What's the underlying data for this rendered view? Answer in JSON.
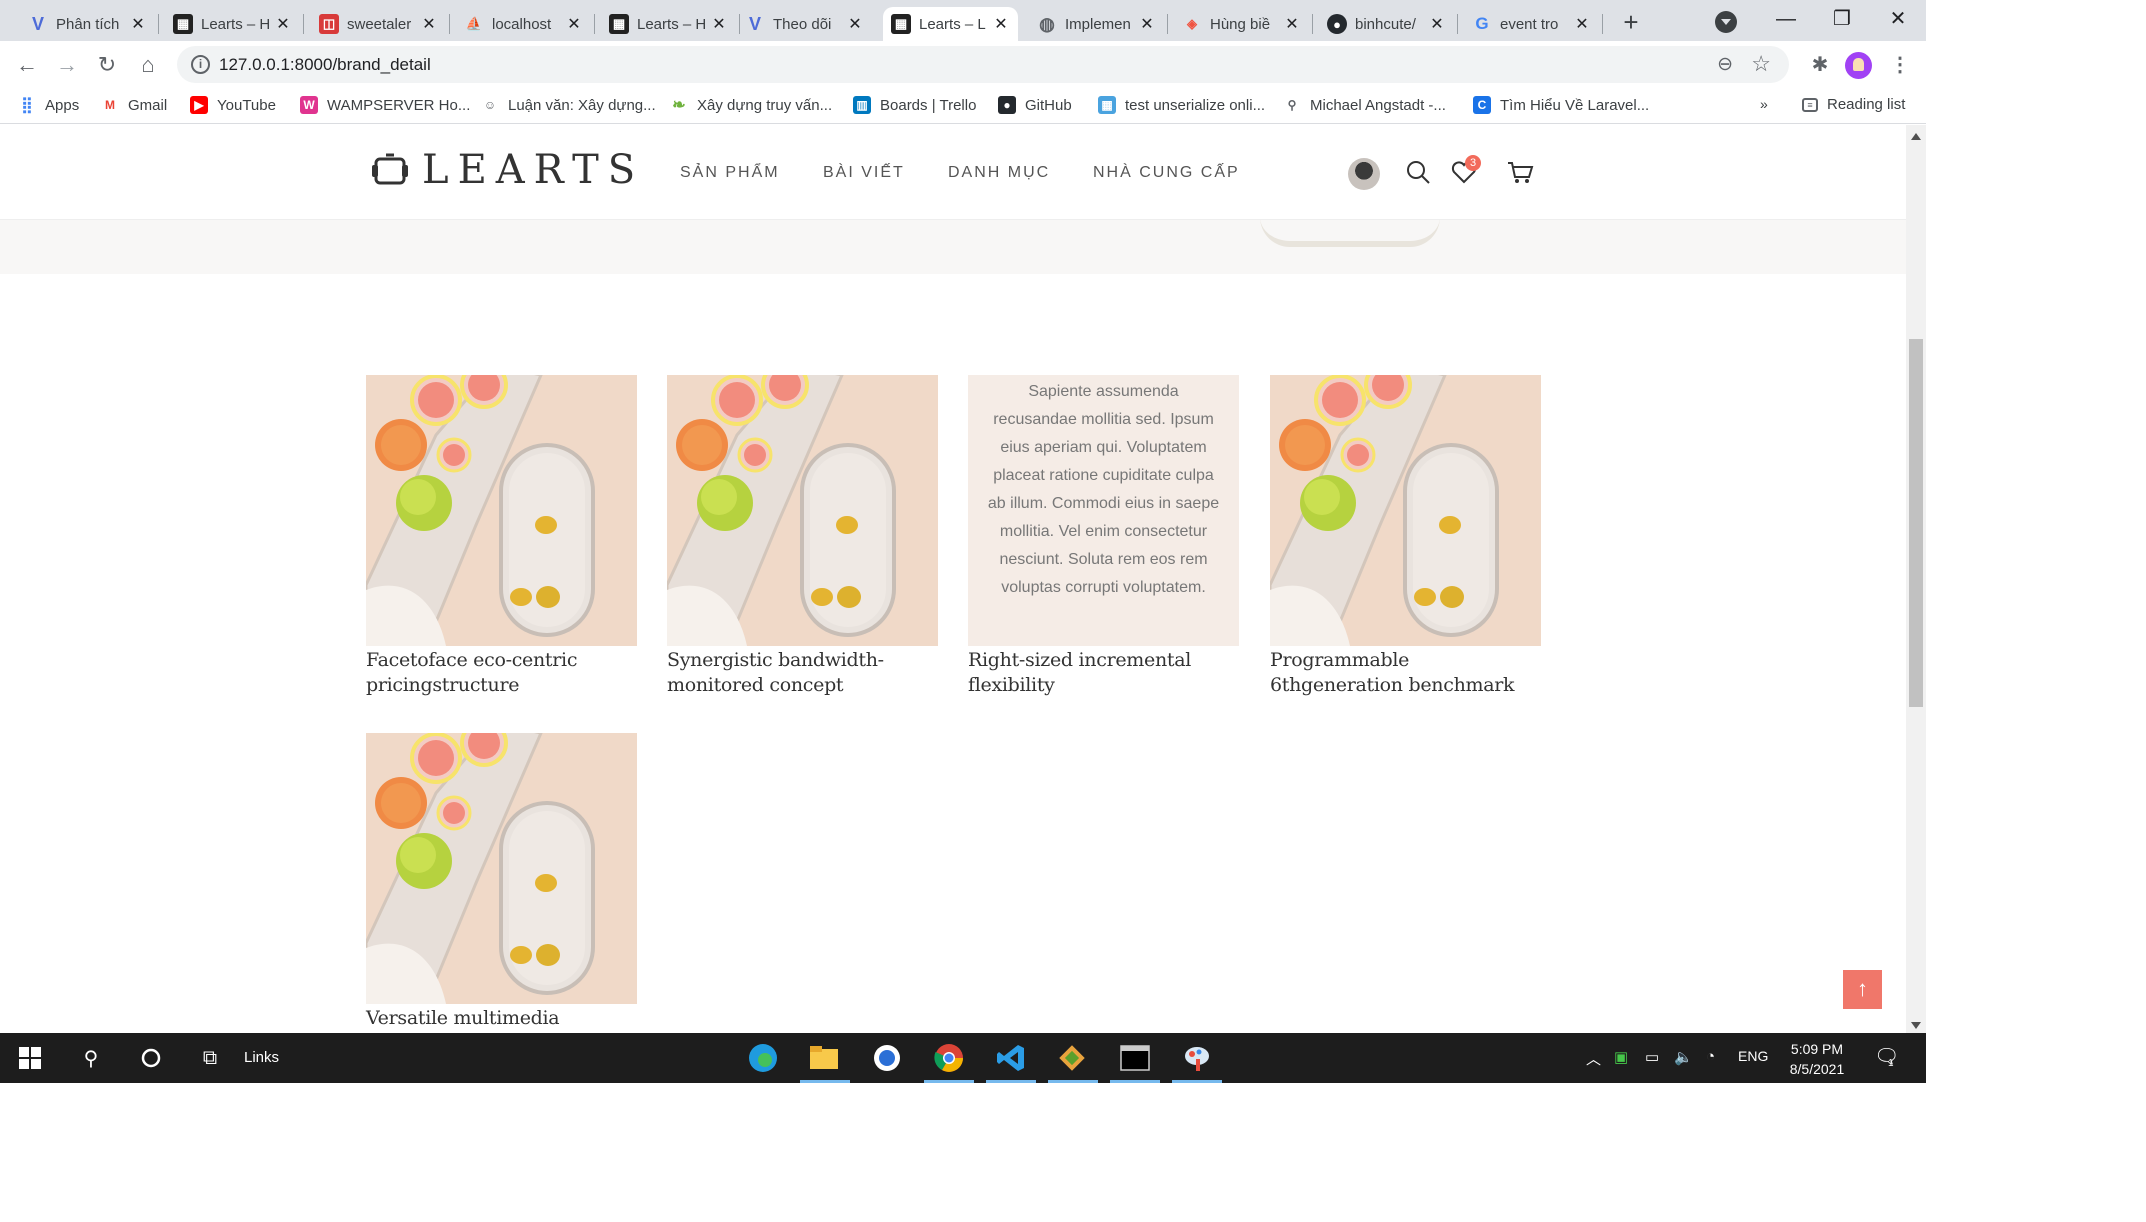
{
  "browser": {
    "tabs": [
      {
        "label": "Phân tích",
        "icon": "v-icon",
        "active": false
      },
      {
        "label": "Learts – H",
        "icon": "learts-favicon",
        "active": false
      },
      {
        "label": "sweetaler",
        "icon": "sweetalert-favicon",
        "active": false
      },
      {
        "label": "localhost",
        "icon": "phpmyadmin-favicon",
        "active": false
      },
      {
        "label": "Learts – H",
        "icon": "learts-favicon",
        "active": false
      },
      {
        "label": "Theo dõi",
        "icon": "v-icon",
        "active": false
      },
      {
        "label": "Learts – L",
        "icon": "learts-favicon",
        "active": true
      },
      {
        "label": "Implemen",
        "icon": "globe-icon",
        "active": false
      },
      {
        "label": "Hùng biề",
        "icon": "laravel-favicon",
        "active": false
      },
      {
        "label": "binhcute/",
        "icon": "github-icon",
        "active": false
      },
      {
        "label": "event tro",
        "icon": "google-icon",
        "active": false
      }
    ],
    "close_glyph": "✕",
    "new_tab": "+",
    "url": "127.0.0.1:8000/brand_detail",
    "bookmarks": [
      {
        "label": "Apps",
        "icon": "apps-grid-icon",
        "color": "#4285f4"
      },
      {
        "label": "Gmail",
        "icon": "gmail-icon",
        "color": "#ea4335"
      },
      {
        "label": "YouTube",
        "icon": "youtube-icon",
        "color": "#ff0000"
      },
      {
        "label": "WAMPSERVER Ho...",
        "icon": "wamp-icon",
        "color": "#e0348f"
      },
      {
        "label": "Luận văn: Xây dựng...",
        "icon": "thesis-icon",
        "color": "#ffffff"
      },
      {
        "label": "Xây dựng truy vấn...",
        "icon": "leaf-icon",
        "color": "#6fb23d"
      },
      {
        "label": "Boards | Trello",
        "icon": "trello-icon",
        "color": "#0079bf"
      },
      {
        "label": "GitHub",
        "icon": "github-icon",
        "color": "#24292e"
      },
      {
        "label": "test unserialize onli...",
        "icon": "tool-icon",
        "color": "#4aa3df"
      },
      {
        "label": "Michael Angstadt -...",
        "icon": "search-icon",
        "color": "#ffffff"
      },
      {
        "label": "Tìm Hiểu Về Laravel...",
        "icon": "c-icon",
        "color": "#1a73e8"
      }
    ],
    "overflow": "»",
    "reading_list": "Reading list"
  },
  "site": {
    "logo_text": "LEARTS",
    "nav": [
      "SẢN PHẨM",
      "BÀI VIẾT",
      "DANH MỤC",
      "NHÀ CUNG CẤP"
    ],
    "wishlist_count": "3",
    "accent": "#f26b5b"
  },
  "products": [
    {
      "title": "Facetoface eco-centric pricingstructure",
      "type": "image"
    },
    {
      "title": "Synergistic bandwidth-monitored concept",
      "type": "image"
    },
    {
      "title": "Right-sized incremental flexibility",
      "type": "excerpt",
      "excerpt": "Sapiente assumenda recusandae mollitia sed. Ipsum eius aperiam qui. Voluptatem placeat ratione cupiditate culpa ab illum. Commodi eius in saepe mollitia. Vel enim consectetur nesciunt. Soluta rem eos rem voluptas corrupti voluptatem."
    },
    {
      "title": "Programmable 6thgeneration benchmark",
      "type": "image"
    },
    {
      "title": "Versatile multimedia functionalities",
      "type": "image"
    }
  ],
  "back_to_top": "↑",
  "taskbar": {
    "links_label": "Links",
    "language": "ENG",
    "time": "5:09 PM",
    "date": "8/5/2021",
    "notification_count": "1"
  }
}
